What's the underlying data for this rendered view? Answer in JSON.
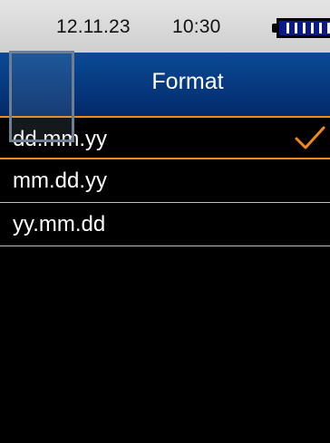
{
  "status_bar": {
    "date": "12.11.23",
    "time": "10:30",
    "battery_icon": "battery-full-icon",
    "battery_level": 1.0
  },
  "header": {
    "title": "Format"
  },
  "format_list": {
    "items": [
      {
        "label": "dd.mm.yy",
        "selected": true
      },
      {
        "label": "mm.dd.yy",
        "selected": false
      },
      {
        "label": "yy.mm.dd",
        "selected": false
      }
    ],
    "check_icon": "checkmark-icon"
  },
  "colors": {
    "header_bg": "#0a4a96",
    "status_bar_bg": "#d9d9d9",
    "selection_accent": "#f08a1a",
    "list_bg": "#000000",
    "divider": "#bfbfbf"
  }
}
